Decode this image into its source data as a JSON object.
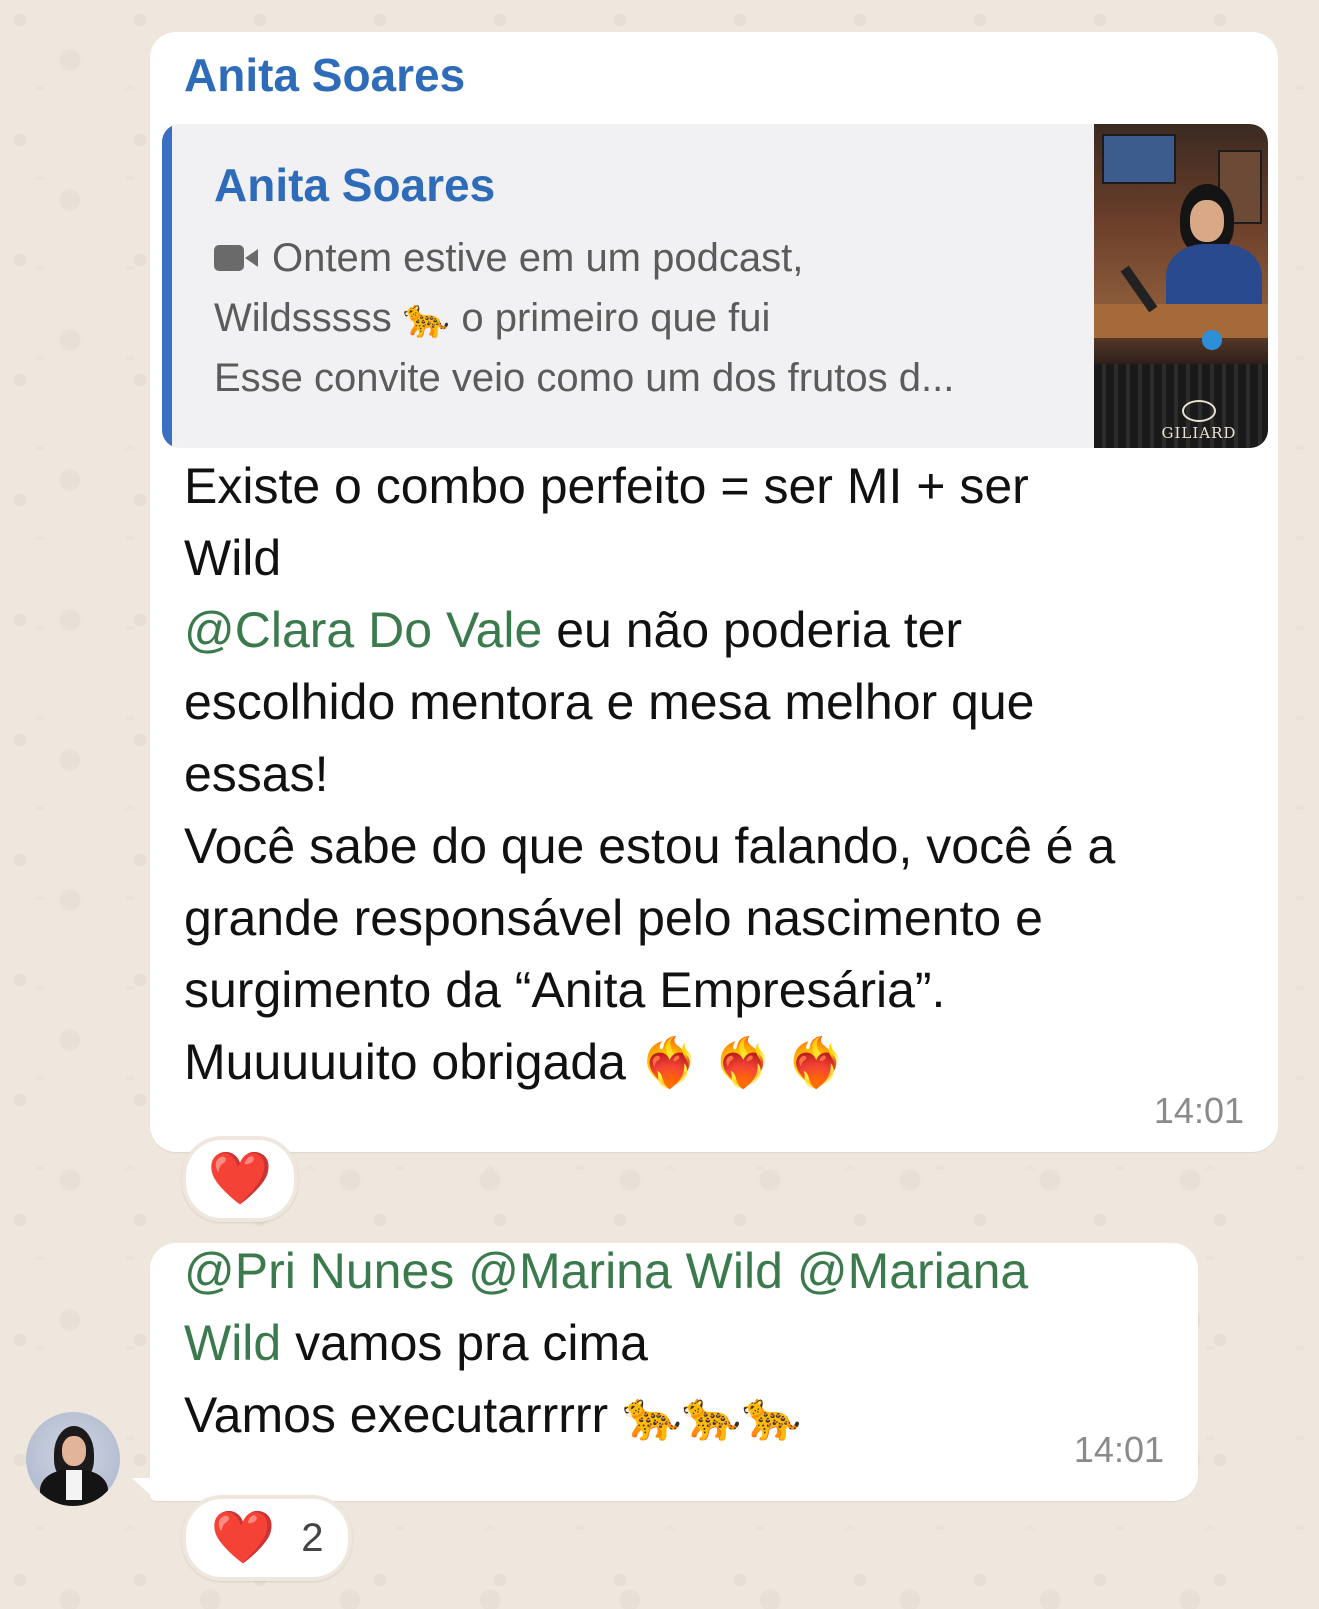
{
  "message1": {
    "sender": "Anita Soares",
    "quote": {
      "author": "Anita Soares",
      "media_icon": "video-camera-icon",
      "line1": "Ontem estive em um podcast,",
      "line2_a": "Wildsssss",
      "line2_emoji": "🐆",
      "line2_b": "o primeiro que fui",
      "line3": "Esse convite veio como um dos frutos d...",
      "thumbnail_logo": "GILIARD"
    },
    "text": {
      "l1": "Existe o combo perfeito = ser MI + ser",
      "l2": "Wild",
      "l3_mention": "@Clara Do Vale",
      "l3_rest": " eu não poderia ter",
      "l4": "escolhido mentora e mesa melhor que",
      "l5": "essas!",
      "l6": "Você sabe do que estou falando, você é a",
      "l7": "grande responsável pelo nascimento e",
      "l8": "surgimento da “Anita Empresária”.",
      "l9": "Muuuuuito obrigada ",
      "l9_emojis": "❤️‍🔥 ❤️‍🔥 ❤️‍🔥"
    },
    "time": "14:01",
    "reaction": {
      "emoji": "❤️",
      "count": ""
    }
  },
  "message2": {
    "text": {
      "m1": "@Pri Nunes",
      "m2": "@Marina Wild",
      "m3a": "@Mariana",
      "m3b": "Wild",
      "l2_rest": " vamos pra cima",
      "l3": "Vamos executarrrrr ",
      "l3_emojis": "🐆🐆🐆"
    },
    "time": "14:01",
    "reaction": {
      "emoji": "❤️",
      "count": "2"
    }
  },
  "colors": {
    "wallpaper": "#efe7dd",
    "bubble": "#ffffff",
    "sender_name": "#2e6bb8",
    "mention": "#3a7a4c",
    "timestamp": "#8a8a8a",
    "quote_bar": "#3a6fc4",
    "heart": "#e01b24"
  }
}
